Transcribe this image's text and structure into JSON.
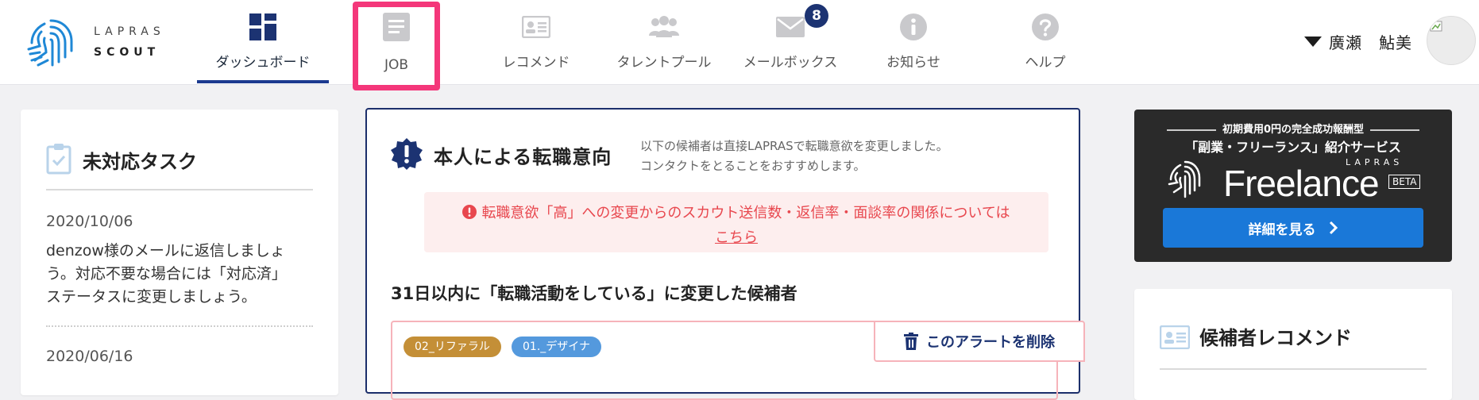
{
  "logo": {
    "line1": "LAPRAS",
    "line2": "SCOUT"
  },
  "nav": {
    "items": [
      {
        "label": "ダッシュボード",
        "icon": "dashboard-icon"
      },
      {
        "label": "JOB",
        "icon": "document-icon"
      },
      {
        "label": "レコメンド",
        "icon": "id-card-icon"
      },
      {
        "label": "タレントプール",
        "icon": "people-icon"
      },
      {
        "label": "メールボックス",
        "icon": "envelope-icon",
        "badge": "8"
      },
      {
        "label": "お知らせ",
        "icon": "info-icon"
      },
      {
        "label": "ヘルプ",
        "icon": "help-icon"
      }
    ],
    "active": "ダッシュボード",
    "highlighted": "JOB",
    "highlight_color": "#f4377a"
  },
  "user": {
    "name": "廣瀬　鮎美"
  },
  "tasks": {
    "title": "未対応タスク",
    "items": [
      {
        "date": "2020/10/06",
        "text": "denzow様のメールに返信しましょう。対応不要な場合には「対応済」ステータスに変更しましょう。"
      },
      {
        "date": "2020/06/16"
      }
    ]
  },
  "intent": {
    "title": "本人による転職意向",
    "description_line1": "以下の候補者は直接LAPRASで転職意欲を変更しました。",
    "description_line2": "コンタクトをとることをおすすめします。",
    "notice_text": "転職意欲「高」への変更からのスカウト送信数・返信率・面談率の関係については",
    "notice_link": "こちら",
    "candidates_heading": "31日以内に「転職活動をしている」に変更した候補者",
    "candidate": {
      "tags": [
        "02_リファラル",
        "01._デザイナ"
      ],
      "delete_label": "このアラートを削除"
    }
  },
  "banner": {
    "top": "初期費用0円の完全成功報酬型",
    "subtitle": "「副業・フリーランス」紹介サービス",
    "brand_small": "LAPRAS",
    "brand": "Freelance",
    "beta": "BETA",
    "button": "詳細を見る"
  },
  "recommend": {
    "title": "候補者レコメンド"
  },
  "colors": {
    "brand_navy": "#1c3372",
    "alert_red": "#e8474e",
    "cta_blue": "#1a78d8"
  }
}
